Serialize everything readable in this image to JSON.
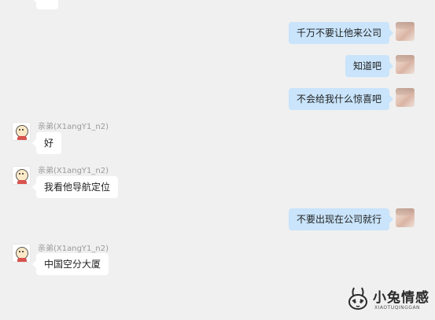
{
  "messages": [
    {
      "direction": "in",
      "text": ""
    },
    {
      "direction": "out",
      "text": "千万不要让他来公司"
    },
    {
      "direction": "out",
      "text": "知道吧"
    },
    {
      "direction": "out",
      "text": "不会给我什么惊喜吧"
    },
    {
      "direction": "in",
      "sender": "亲弟(X1angY1_n2)",
      "text": "好"
    },
    {
      "direction": "in",
      "sender": "亲弟(X1angY1_n2)",
      "text": "我看他导航定位"
    },
    {
      "direction": "out",
      "text": "不要出现在公司就行"
    },
    {
      "direction": "in",
      "sender": "亲弟(X1angY1_n2)",
      "text": "中国空分大厦"
    }
  ],
  "watermark": {
    "title": "小兔情感",
    "subtitle": "XIAOTUQINGGAN"
  },
  "colors": {
    "background": "#f0f0f0",
    "outgoing_bubble": "#c9e4fb",
    "incoming_bubble": "#ffffff",
    "sender_name": "#9a9a9a"
  }
}
